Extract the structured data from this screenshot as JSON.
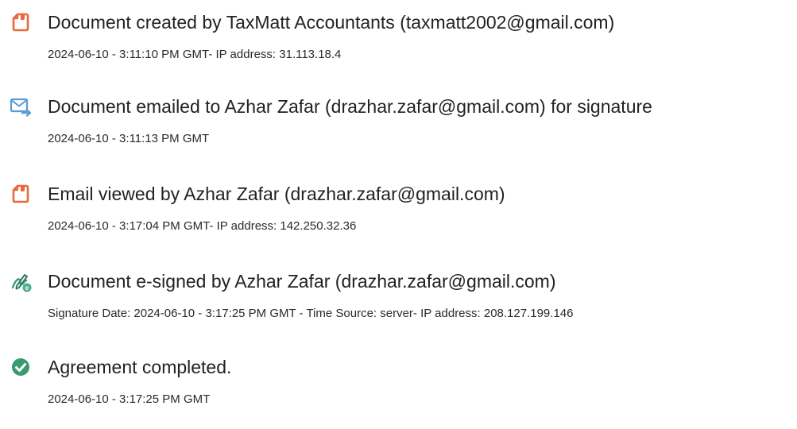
{
  "events": [
    {
      "icon": "document-created-icon",
      "title": "Document created by TaxMatt Accountants (taxmatt2002@gmail.com)",
      "detail": "2024-06-10 - 3:11:10 PM GMT- IP address: 31.113.18.4"
    },
    {
      "icon": "email-sent-icon",
      "title": "Document emailed to Azhar Zafar (drazhar.zafar@gmail.com) for signature",
      "detail": "2024-06-10 - 3:11:13 PM GMT"
    },
    {
      "icon": "email-viewed-icon",
      "title": "Email viewed by Azhar Zafar (drazhar.zafar@gmail.com)",
      "detail": "2024-06-10 - 3:17:04 PM GMT- IP address: 142.250.32.36"
    },
    {
      "icon": "e-signed-icon",
      "title": "Document e-signed by Azhar Zafar (drazhar.zafar@gmail.com)",
      "detail": "Signature Date: 2024-06-10 - 3:17:25 PM GMT - Time Source: server- IP address: 208.127.199.146"
    },
    {
      "icon": "check-circle-icon",
      "title": "Agreement completed.",
      "detail": "2024-06-10 - 3:17:25 PM GMT"
    }
  ],
  "colors": {
    "document_icon": "#e8693c",
    "email_icon": "#5b9bd5",
    "sign_icon_green": "#4caf8a",
    "check_icon": "#3a9b6e"
  }
}
